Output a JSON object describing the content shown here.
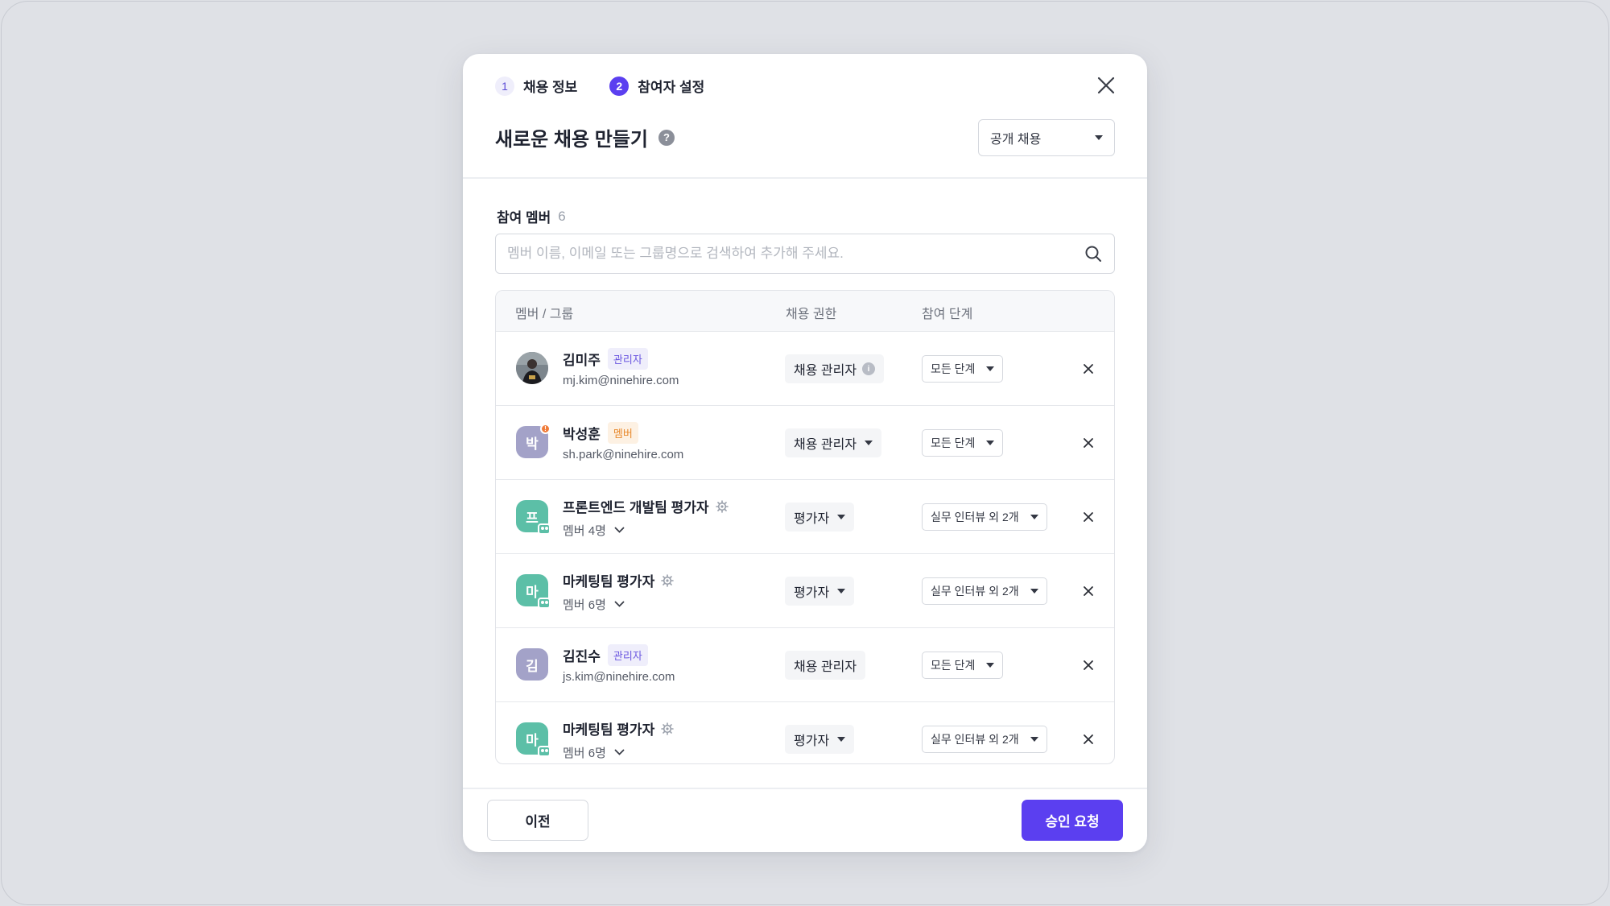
{
  "steps": [
    {
      "num": "1",
      "label": "채용 정보"
    },
    {
      "num": "2",
      "label": "참여자 설정"
    }
  ],
  "modal": {
    "title": "새로운 채용 만들기",
    "help": "?",
    "type_select": "공개 채용"
  },
  "members": {
    "title": "참여 멤버",
    "count": "6",
    "search_placeholder": "멤버 이름, 이메일 또는 그룹명으로 검색하여 추가해 주세요.",
    "columns": [
      "멤버 / 그룹",
      "채용 권한",
      "참여 단계"
    ],
    "rows": [
      {
        "avatar": "photo",
        "initial": "",
        "name": "김미주",
        "badge": "관리자",
        "badge_type": "admin",
        "sub": "mj.kim@ninehire.com",
        "role": "채용 관리자",
        "role_info": "i",
        "stage": "모든 단계"
      },
      {
        "avatar": "purple",
        "initial": "박",
        "name": "박성훈",
        "badge": "멤버",
        "badge_type": "member",
        "sub": "sh.park@ninehire.com",
        "role": "채용 관리자",
        "stage": "모든 단계"
      },
      {
        "avatar": "teal",
        "initial": "프",
        "name": "프론트엔드 개발팀 평가자",
        "sub": "멤버 4명",
        "role": "평가자",
        "stage": "실무 인터뷰 외 2개"
      },
      {
        "avatar": "teal",
        "initial": "마",
        "name": "마케팅팀 평가자",
        "sub": "멤버 6명",
        "role": "평가자",
        "stage": "실무 인터뷰 외 2개"
      },
      {
        "avatar": "purple",
        "initial": "김",
        "name": "김진수",
        "badge": "관리자",
        "badge_type": "admin",
        "sub": "js.kim@ninehire.com",
        "role": "채용 관리자",
        "stage": "모든 단계"
      },
      {
        "avatar": "teal",
        "initial": "마",
        "name": "마케팅팀 평가자",
        "sub": "멤버 6명",
        "role": "평가자",
        "stage": "실무 인터뷰 외 2개"
      }
    ]
  },
  "footer": {
    "prev_label": "이전",
    "submit_label": "승인 요청"
  },
  "colors": {
    "accent": "#5b3ff0",
    "admin_badge_text": "#6b57e0",
    "member_badge_text": "#e88a2f",
    "group_avatar": "#5cbfa7",
    "person_avatar": "#a3a2c8"
  },
  "icons": [
    "close-icon",
    "help-icon",
    "search-icon",
    "info-icon",
    "gear-icon",
    "chevron-down-icon",
    "caret-down-icon",
    "remove-icon",
    "group-icon",
    "alert-dot-icon"
  ]
}
